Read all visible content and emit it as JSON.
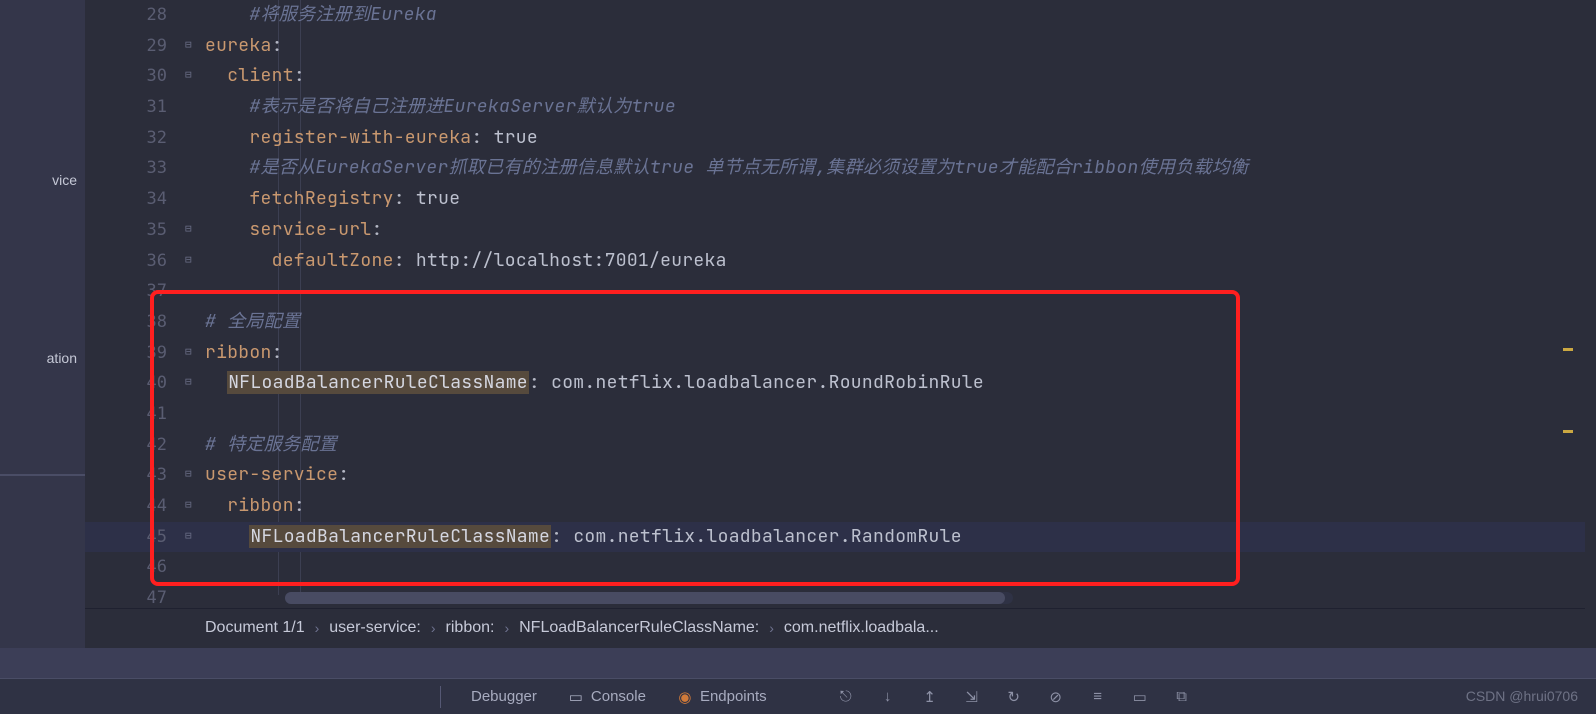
{
  "sidebar": {
    "items": [
      "vice",
      "ation"
    ]
  },
  "code": {
    "lines": [
      {
        "n": "28",
        "tokens": [
          {
            "t": "    ",
            "c": ""
          },
          {
            "t": "#将服务注册到Eureka",
            "c": "c-comment"
          }
        ]
      },
      {
        "n": "29",
        "fold": "⊟",
        "tokens": [
          {
            "t": "eureka",
            "c": "c-key"
          },
          {
            "t": ":",
            "c": ""
          }
        ]
      },
      {
        "n": "30",
        "fold": "⊟",
        "tokens": [
          {
            "t": "  ",
            "c": ""
          },
          {
            "t": "client",
            "c": "c-key"
          },
          {
            "t": ":",
            "c": ""
          }
        ]
      },
      {
        "n": "31",
        "tokens": [
          {
            "t": "    ",
            "c": ""
          },
          {
            "t": "#表示是否将自己注册进EurekaServer默认为true",
            "c": "c-comment"
          }
        ]
      },
      {
        "n": "32",
        "tokens": [
          {
            "t": "    ",
            "c": ""
          },
          {
            "t": "register-with-eureka",
            "c": "c-key"
          },
          {
            "t": ": ",
            "c": ""
          },
          {
            "t": "true",
            "c": "c-val"
          }
        ]
      },
      {
        "n": "33",
        "tokens": [
          {
            "t": "    ",
            "c": ""
          },
          {
            "t": "#是否从EurekaServer抓取已有的注册信息默认true 单节点无所谓,集群必须设置为true才能配合ribbon使用负载均衡",
            "c": "c-comment"
          }
        ]
      },
      {
        "n": "34",
        "tokens": [
          {
            "t": "    ",
            "c": ""
          },
          {
            "t": "fetchRegistry",
            "c": "c-key"
          },
          {
            "t": ": ",
            "c": ""
          },
          {
            "t": "true",
            "c": "c-val"
          }
        ]
      },
      {
        "n": "35",
        "fold": "⊟",
        "tokens": [
          {
            "t": "    ",
            "c": ""
          },
          {
            "t": "service-url",
            "c": "c-key"
          },
          {
            "t": ":",
            "c": ""
          }
        ]
      },
      {
        "n": "36",
        "fold": "⊟",
        "tokens": [
          {
            "t": "      ",
            "c": ""
          },
          {
            "t": "defaultZone",
            "c": "c-key"
          },
          {
            "t": ": ",
            "c": ""
          },
          {
            "t": "http://localhost:7001/eureka",
            "c": "c-val"
          }
        ]
      },
      {
        "n": "37",
        "tokens": []
      },
      {
        "n": "38",
        "tokens": [
          {
            "t": "# 全局配置",
            "c": "c-comment"
          }
        ]
      },
      {
        "n": "39",
        "fold": "⊟",
        "tokens": [
          {
            "t": "ribbon",
            "c": "c-key"
          },
          {
            "t": ":",
            "c": ""
          }
        ]
      },
      {
        "n": "40",
        "fold": "⊟",
        "tokens": [
          {
            "t": "  ",
            "c": ""
          },
          {
            "t": "NFLoadBalancerRuleClassName",
            "c": "c-hl"
          },
          {
            "t": ": ",
            "c": ""
          },
          {
            "t": "com.netflix.loadbalancer.RoundRobinRule",
            "c": "c-val"
          }
        ]
      },
      {
        "n": "41",
        "tokens": []
      },
      {
        "n": "42",
        "tokens": [
          {
            "t": "# 特定服务配置",
            "c": "c-comment"
          }
        ]
      },
      {
        "n": "43",
        "fold": "⊟",
        "tokens": [
          {
            "t": "user-service",
            "c": "c-key"
          },
          {
            "t": ":",
            "c": ""
          }
        ]
      },
      {
        "n": "44",
        "fold": "⊟",
        "tokens": [
          {
            "t": "  ",
            "c": ""
          },
          {
            "t": "ribbon",
            "c": "c-key"
          },
          {
            "t": ":",
            "c": ""
          }
        ]
      },
      {
        "n": "45",
        "fold": "⊟",
        "current": true,
        "tokens": [
          {
            "t": "    ",
            "c": ""
          },
          {
            "t": "NFLoadBalancerRuleClassName",
            "c": "c-hl"
          },
          {
            "t": ": ",
            "c": ""
          },
          {
            "t": "com.netflix.loadbalancer.RandomRule",
            "c": "c-val"
          }
        ]
      },
      {
        "n": "46",
        "tokens": []
      },
      {
        "n": "47",
        "tokens": []
      }
    ]
  },
  "breadcrumb": {
    "segments": [
      "Document 1/1",
      "user-service:",
      "ribbon:",
      "NFLoadBalancerRuleClassName:",
      "com.netflix.loadbala..."
    ]
  },
  "bottombar": {
    "tabs": [
      "Debugger",
      "Console",
      "Endpoints"
    ],
    "icons": [
      "⎋",
      "↓",
      "↥",
      "⇲",
      "↻",
      "⊘",
      "≡",
      "▭",
      "⧉"
    ]
  },
  "watermark": "CSDN @hrui0706",
  "ruler_marks": [
    348,
    430
  ]
}
